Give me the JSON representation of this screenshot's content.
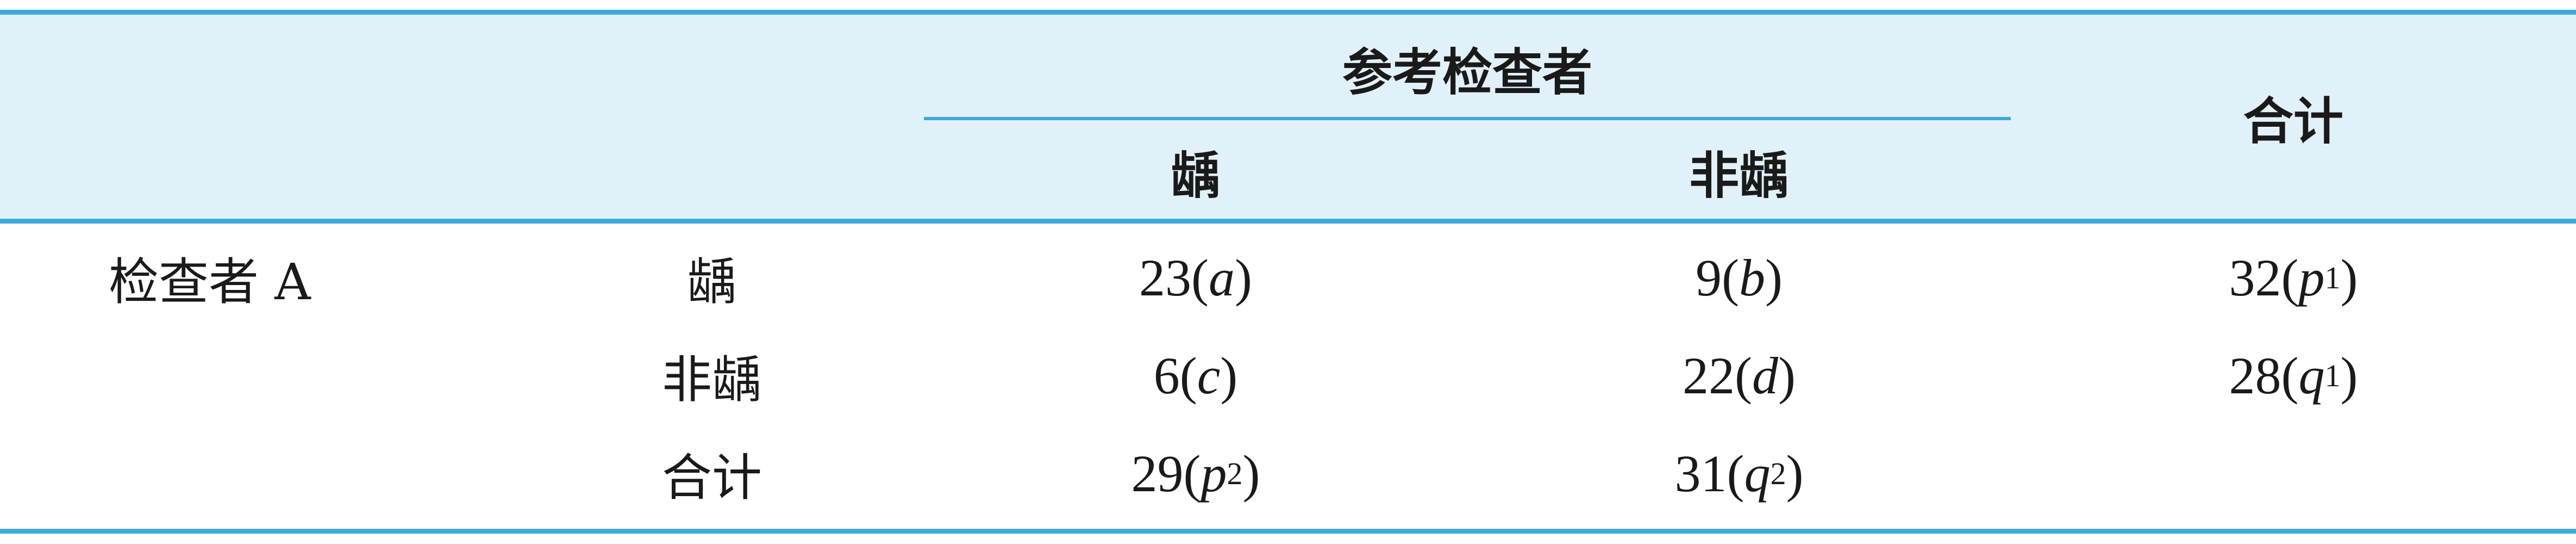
{
  "header": {
    "group_label": "参考检查者",
    "col_caries": "龋",
    "col_noncaries": "非龋",
    "col_total": "合计"
  },
  "stub": {
    "row_group_label": "检查者 A",
    "rows": [
      "龋",
      "非龋",
      "合计"
    ]
  },
  "cells": [
    [
      {
        "value": "23",
        "sym": "a",
        "sub": ""
      },
      {
        "value": "9",
        "sym": "b",
        "sub": ""
      },
      {
        "value": "32",
        "sym": "p",
        "sub": "1"
      }
    ],
    [
      {
        "value": "6",
        "sym": "c",
        "sub": ""
      },
      {
        "value": "22",
        "sym": "d",
        "sub": ""
      },
      {
        "value": "28",
        "sym": "q",
        "sub": "1"
      }
    ],
    [
      {
        "value": "29",
        "sym": "p",
        "sub": "2"
      },
      {
        "value": "31",
        "sym": "q",
        "sub": "2"
      }
    ]
  ],
  "colors": {
    "rule": "#3fa9da",
    "header_fill": "#e1f1f9",
    "text": "#1a1a1a"
  }
}
